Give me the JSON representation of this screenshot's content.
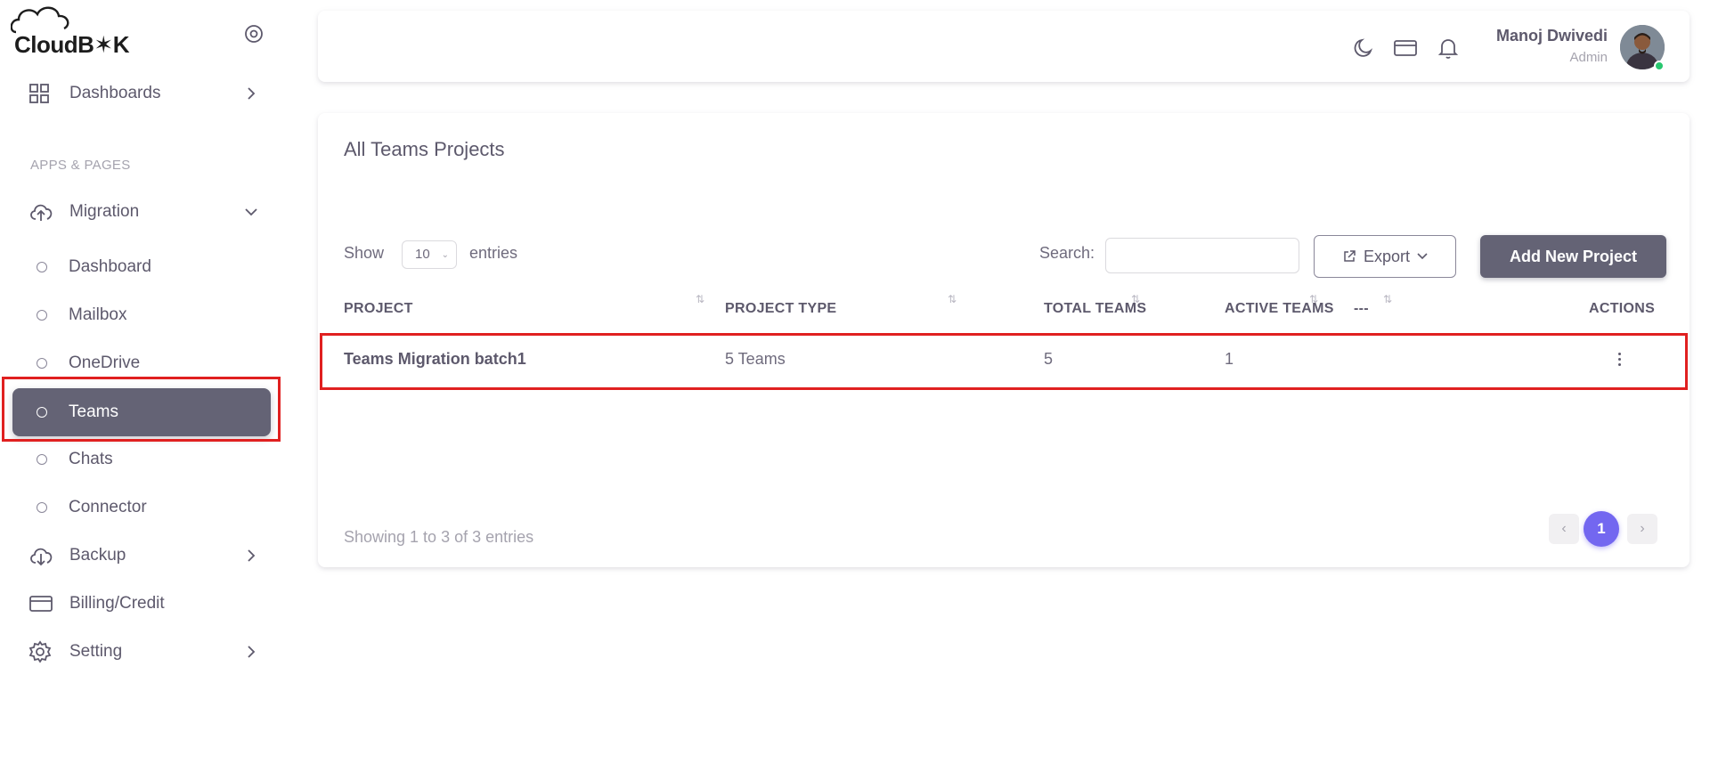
{
  "brand": {
    "logo_text": "CloudB✶K"
  },
  "sidebar": {
    "dashboards_label": "Dashboards",
    "section_header": "APPS & PAGES",
    "migration_label": "Migration",
    "migration_items": [
      {
        "label": "Dashboard"
      },
      {
        "label": "Mailbox"
      },
      {
        "label": "OneDrive"
      },
      {
        "label": "Teams",
        "active": true
      },
      {
        "label": "Chats"
      },
      {
        "label": "Connector"
      }
    ],
    "backup_label": "Backup",
    "billing_label": "Billing/Credit",
    "setting_label": "Setting",
    "active_color": "#646375"
  },
  "topbar": {
    "user_name": "Manoj Dwivedi",
    "user_role": "Admin",
    "icons": [
      "moon-icon",
      "credit-card-icon",
      "bell-icon"
    ],
    "online_color": "#28c76f"
  },
  "card": {
    "title": "All Teams Projects",
    "show_label": "Show",
    "page_length": "10",
    "entries_label": "entries",
    "search_label": "Search:",
    "search_value": "",
    "export_label": "Export",
    "add_button_label": "Add New Project",
    "columns": [
      "PROJECT",
      "PROJECT TYPE",
      "TOTAL TEAMS",
      "ACTIVE TEAMS",
      "---",
      "ACTIONS"
    ],
    "rows": [
      {
        "project": "Teams Migration batch1",
        "project_type": "5 Teams",
        "total_teams": "5",
        "active_teams": "1"
      }
    ],
    "info_text": "Showing 1 to 3 of 3 entries",
    "pagination": {
      "current": "1",
      "prev": "‹",
      "next": "›"
    },
    "accent_color": "#7367f0",
    "highlight_color": "#e02020"
  }
}
